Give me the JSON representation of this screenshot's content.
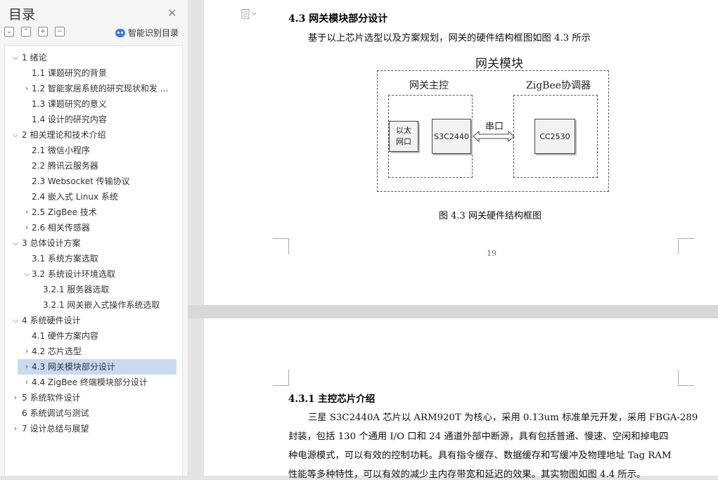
{
  "sidebar": {
    "title": "目录",
    "smart_toc": "智能识别目录",
    "toc": [
      {
        "label": "1  绪论",
        "expanded": true
      },
      {
        "label": "1.1  课题研究的背景"
      },
      {
        "label": "1.2  智能家居系统的研究现状和发 ..."
      },
      {
        "label": "1.3  课题研究的意义"
      },
      {
        "label": "1.4  设计的研究内容"
      },
      {
        "label": "2  相关理论和技术介绍"
      },
      {
        "label": "2.1  微信小程序"
      },
      {
        "label": "2.2  腾讯云服务器"
      },
      {
        "label": "2.3 Websocket 传输协议"
      },
      {
        "label": "2.4  嵌入式 Linux 系统"
      },
      {
        "label": "2.5 ZigBee 技术"
      },
      {
        "label": "2.6  相关传感器"
      },
      {
        "label": "3  总体设计方案"
      },
      {
        "label": "3.1  系统方案选取"
      },
      {
        "label": "3.2  系统设计环境选取"
      },
      {
        "label": "3.2.1  服务器选取"
      },
      {
        "label": "3.2.1  网关嵌入式操作系统选取"
      },
      {
        "label": "4  系统硬件设计"
      },
      {
        "label": "4.1  硬件方案内容"
      },
      {
        "label": "4.2  芯片选型"
      },
      {
        "label": "4.3  网关模块部分设计",
        "selected": true
      },
      {
        "label": "4.4 ZigBee 终端模块部分设计"
      },
      {
        "label": "5  系统软件设计"
      },
      {
        "label": "6  系统调试与测试"
      },
      {
        "label": "7  设计总结与展望"
      }
    ]
  },
  "page1": {
    "heading": "4.3  网关模块部分设计",
    "paragraph": "基于以上芯片选型以及方案规划，网关的硬件结构框图如图 4.3 所示",
    "diagram": {
      "title": "网关模块",
      "main_label": "网关主控",
      "zigbee_label": "ZigBee协调器",
      "ethernet": "以太网口",
      "ethernet_l1": "以太",
      "ethernet_l2": "网口",
      "chip1": "S3C2440",
      "link": "串口",
      "chip2": "CC2530"
    },
    "caption": "图 4.3  网关硬件结构框图",
    "page_number": "19"
  },
  "page2": {
    "heading": "4.3.1  主控芯片介绍",
    "lines": [
      "三星 S3C2440A 芯片以 ARM920T 为核心，采用 0.13um 标准单元开发，采用 FBGA-289",
      "封装，包括 130 个通用 I/O 口和 24 通道外部中断源，具有包括普通、慢速、空闲和掉电四",
      "种电源模式，可以有效的控制功耗。具有指令缓存、数据缓存和写缓冲及物理地址 Tag RAM",
      "性能等多种特性，可以有效的减少主内存带宽和延迟的效果。其实物图如图 4.4 所示。"
    ]
  }
}
